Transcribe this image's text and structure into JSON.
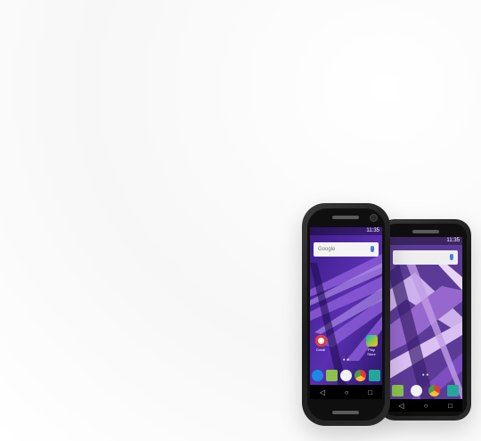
{
  "phones": {
    "front": {
      "status_time": "11:35",
      "search_placeholder": "Google",
      "apps": [
        {
          "label": "Gmail"
        },
        {
          "label": "Play Store"
        }
      ],
      "colors": {
        "wallpaper": "#5a2fb0",
        "accent": "#8a5bd6"
      }
    },
    "back": {
      "status_time": "11:35",
      "colors": {
        "wallpaper": "#5b3b97",
        "accent": "#b58bd8"
      }
    }
  }
}
